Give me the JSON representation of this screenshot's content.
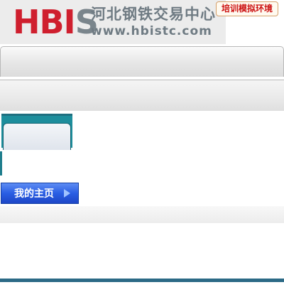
{
  "header": {
    "logo": "HBIS",
    "company_name": "河北钢铁交易中心",
    "website": "www.hbistc.com",
    "env_badge": "培训模拟环境"
  },
  "nav": {
    "home_button_label": "我的主页"
  },
  "colors": {
    "logo_red": "#cf1f2e",
    "logo_gray": "#6f7b83",
    "tab_teal": "#1e8e9c",
    "button_blue": "#2a5ee3",
    "footer_line": "#2c6a86",
    "badge_red": "#cc1111"
  }
}
